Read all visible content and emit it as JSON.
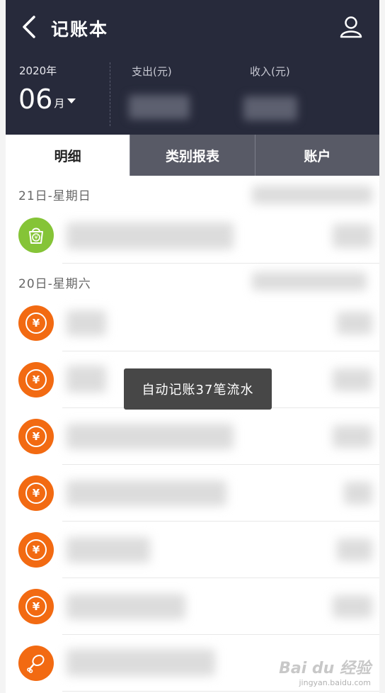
{
  "header": {
    "title": "记账本",
    "year": "2020年",
    "month": "06",
    "month_unit": "月",
    "expense_label": "支出(元)",
    "income_label": "收入(元)",
    "back_icon": "chevron-left-icon",
    "profile_icon": "user-icon"
  },
  "tabs": [
    {
      "label": "明细",
      "active": true
    },
    {
      "label": "类别报表",
      "active": false
    },
    {
      "label": "账户",
      "active": false
    }
  ],
  "groups": [
    {
      "date": "21日-星期日"
    },
    {
      "date": "20日-星期六"
    }
  ],
  "rows": [
    {
      "icon": "shopping-bag-icon",
      "color": "#85c437"
    },
    {
      "icon": "yen-icon",
      "color": "#f26a12"
    },
    {
      "icon": "yen-icon",
      "color": "#f26a12"
    },
    {
      "icon": "yen-icon",
      "color": "#f26a12"
    },
    {
      "icon": "yen-icon",
      "color": "#f26a12"
    },
    {
      "icon": "yen-icon",
      "color": "#f26a12"
    },
    {
      "icon": "yen-icon",
      "color": "#f26a12"
    },
    {
      "icon": "drumstick-icon",
      "color": "#f26a12"
    }
  ],
  "yen_symbol": "¥",
  "toast": "自动记账37笔流水",
  "watermark": {
    "main": "Bai du 经验",
    "sub": "jingyan.baidu.com"
  }
}
